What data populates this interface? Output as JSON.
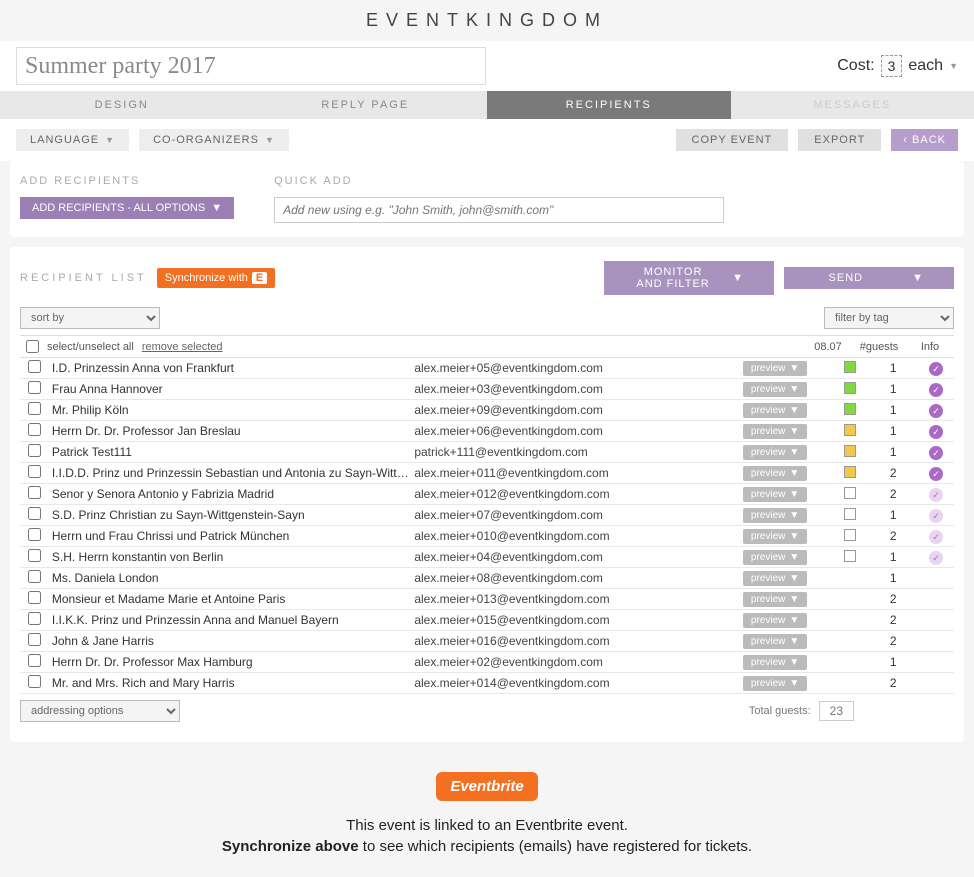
{
  "brand": "EVENTKINGDOM",
  "title": "Summer party 2017",
  "cost": {
    "label": "Cost:",
    "value": "3",
    "each": "each"
  },
  "tabs": [
    "DESIGN",
    "REPLY PAGE",
    "RECIPIENTS",
    "MESSAGES"
  ],
  "toolbar": {
    "lang": "LANGUAGE",
    "coorg": "CO-ORGANIZERS",
    "copy": "COPY EVENT",
    "export": "EXPORT",
    "back": "BACK"
  },
  "add": {
    "title": "ADD RECIPIENTS",
    "btn": "ADD RECIPIENTS - ALL OPTIONS"
  },
  "quick": {
    "title": "QUICK ADD",
    "placeholder": "Add new using e.g. \"John Smith, john@smith.com\""
  },
  "list": {
    "title": "RECIPIENT LIST",
    "sync": "Synchronize with",
    "monitor": "MONITOR AND FILTER",
    "send": "SEND"
  },
  "sort": {
    "sortby": "sort by",
    "filtertag": "filter by tag",
    "selectall": "select/unselect all",
    "remove": "remove selected",
    "addressing": "addressing options"
  },
  "cols": {
    "date": "08.07",
    "guests": "#guests",
    "info": "Info"
  },
  "rows": [
    {
      "name": "I.D. Prinzessin Anna von Frankfurt",
      "email": "alex.meier+05@eventkingdom.com",
      "sq": "g",
      "g": "1",
      "ck": "s"
    },
    {
      "name": "Frau Anna Hannover",
      "email": "alex.meier+03@eventkingdom.com",
      "sq": "g",
      "g": "1",
      "ck": "s"
    },
    {
      "name": "Mr. Philip Köln",
      "email": "alex.meier+09@eventkingdom.com",
      "sq": "g",
      "g": "1",
      "ck": "s"
    },
    {
      "name": "Herrn Dr. Dr. Professor Jan Breslau",
      "email": "alex.meier+06@eventkingdom.com",
      "sq": "y",
      "g": "1",
      "ck": "s"
    },
    {
      "name": "Patrick Test111",
      "email": "patrick+111@eventkingdom.com",
      "sq": "y",
      "g": "1",
      "ck": "s"
    },
    {
      "name": "I.I.D.D. Prinz und Prinzessin Sebastian und Antonia zu Sayn-Wittgenstein-Sayn",
      "email": "alex.meier+011@eventkingdom.com",
      "sq": "y",
      "g": "2",
      "ck": "s"
    },
    {
      "name": "Senor y Senora Antonio y Fabrizia Madrid",
      "email": "alex.meier+012@eventkingdom.com",
      "sq": "e",
      "g": "2",
      "ck": "w"
    },
    {
      "name": "S.D. Prinz Christian zu Sayn-Wittgenstein-Sayn",
      "email": "alex.meier+07@eventkingdom.com",
      "sq": "e",
      "g": "1",
      "ck": "w"
    },
    {
      "name": "Herrn und Frau Chrissi und Patrick München",
      "email": "alex.meier+010@eventkingdom.com",
      "sq": "e",
      "g": "2",
      "ck": "w"
    },
    {
      "name": "S.H. Herrn konstantin von Berlin",
      "email": "alex.meier+04@eventkingdom.com",
      "sq": "e",
      "g": "1",
      "ck": "w"
    },
    {
      "name": "Ms. Daniela London",
      "email": "alex.meier+08@eventkingdom.com",
      "sq": "",
      "g": "1",
      "ck": ""
    },
    {
      "name": "Monsieur et Madame Marie et Antoine Paris",
      "email": "alex.meier+013@eventkingdom.com",
      "sq": "",
      "g": "2",
      "ck": ""
    },
    {
      "name": "I.I.K.K. Prinz und Prinzessin Anna and Manuel Bayern",
      "email": "alex.meier+015@eventkingdom.com",
      "sq": "",
      "g": "2",
      "ck": ""
    },
    {
      "name": "John & Jane Harris",
      "email": "alex.meier+016@eventkingdom.com",
      "sq": "",
      "g": "2",
      "ck": ""
    },
    {
      "name": "Herrn Dr. Dr. Professor Max Hamburg",
      "email": "alex.meier+02@eventkingdom.com",
      "sq": "",
      "g": "1",
      "ck": ""
    },
    {
      "name": "Mr. and Mrs. Rich and Mary Harris",
      "email": "alex.meier+014@eventkingdom.com",
      "sq": "",
      "g": "2",
      "ck": ""
    }
  ],
  "preview": "preview",
  "total": {
    "label": "Total guests:",
    "value": "23"
  },
  "footer": {
    "logo": "Eventbrite",
    "l1": "This event is linked to an Eventbrite event.",
    "l2a": "Synchronize above",
    "l2b": " to see which recipients (emails) have registered for tickets."
  }
}
